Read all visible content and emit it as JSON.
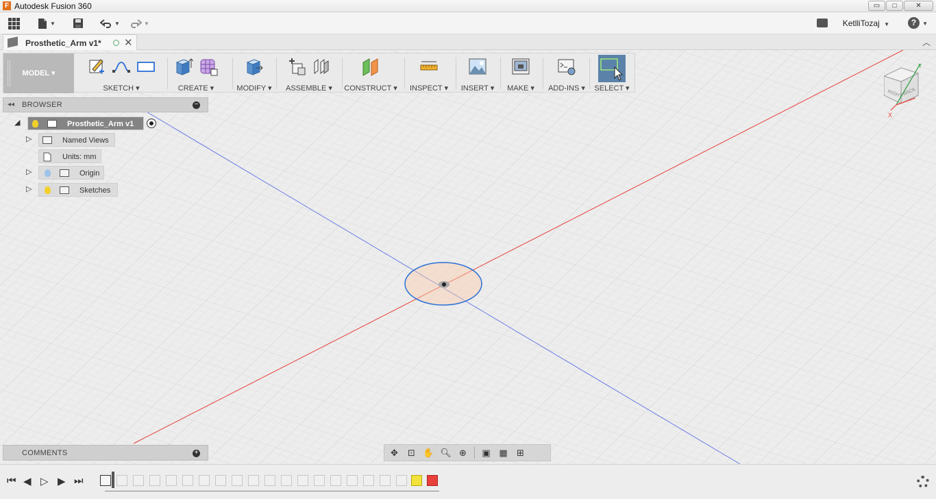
{
  "window": {
    "title": "Autodesk Fusion 360",
    "logo_letter": "F",
    "minimize": "▭",
    "maximize": "□",
    "close": "✕"
  },
  "appbar": {
    "user": "KetlliTozaj",
    "help": "?"
  },
  "tab": {
    "label": "Prosthetic_Arm v1*"
  },
  "toolbar": {
    "workspace": "MODEL",
    "groups": [
      "SKETCH",
      "CREATE",
      "MODIFY",
      "ASSEMBLE",
      "CONSTRUCT",
      "INSPECT",
      "INSERT",
      "MAKE",
      "ADD-INS",
      "SELECT"
    ]
  },
  "browser": {
    "title": "BROWSER",
    "root": "Prosthetic_Arm v1",
    "items": [
      "Named Views",
      "Units: mm",
      "Origin",
      "Sketches"
    ]
  },
  "comments": {
    "title": "COMMENTS"
  },
  "colors": {
    "x_axis": "#e8403a",
    "y_axis": "#5a6ee0",
    "sketch": "#2a6fd6",
    "selected": "#5b82a8"
  }
}
